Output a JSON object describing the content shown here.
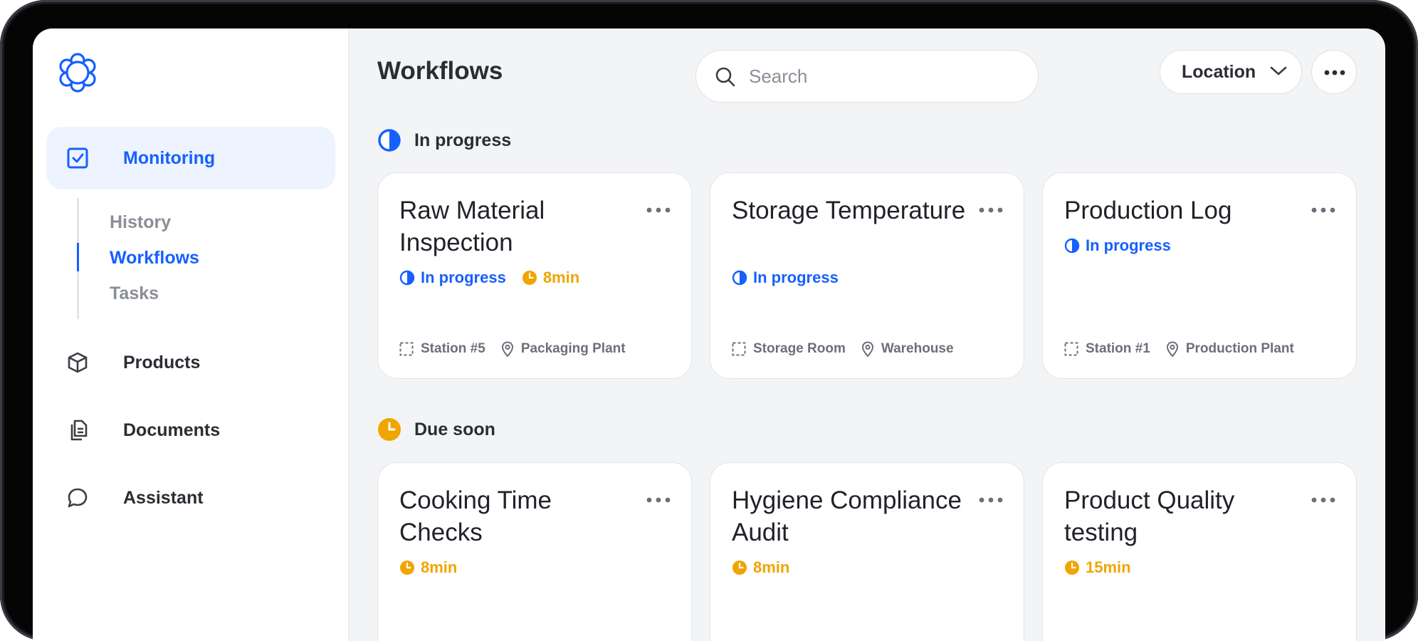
{
  "sidebar": {
    "logo": "flower-logo",
    "main_item": {
      "label": "Monitoring",
      "icon": "check-square-icon"
    },
    "sub_items": [
      {
        "label": "History",
        "active": false
      },
      {
        "label": "Workflows",
        "active": true
      },
      {
        "label": "Tasks",
        "active": false
      }
    ],
    "items": [
      {
        "label": "Products",
        "icon": "cube-icon"
      },
      {
        "label": "Documents",
        "icon": "documents-icon"
      },
      {
        "label": "Assistant",
        "icon": "chat-bubble-icon"
      }
    ]
  },
  "header": {
    "title": "Workflows",
    "search_placeholder": "Search",
    "location_label": "Location"
  },
  "sections": [
    {
      "label": "In progress",
      "cards": [
        {
          "title": "Raw Material Inspection",
          "status": "In progress",
          "duration": "8min",
          "station": "Station #5",
          "location": "Packaging Plant"
        },
        {
          "title": "Storage Temperature",
          "status": "In progress",
          "duration": "",
          "station": "Storage Room",
          "location": "Warehouse"
        },
        {
          "title": "Production Log",
          "status": "In progress",
          "duration": "",
          "station": "Station #1",
          "location": "Production Plant"
        }
      ]
    },
    {
      "label": "Due soon",
      "cards": [
        {
          "title": "Cooking Time Checks",
          "duration": "8min"
        },
        {
          "title": "Hygiene Compliance Audit",
          "duration": "8min"
        },
        {
          "title": "Product Quality testing",
          "duration": "15min"
        }
      ]
    }
  ],
  "colors": {
    "accent": "#1560ff",
    "amber": "#f0a500",
    "background": "#f3f4f6"
  }
}
